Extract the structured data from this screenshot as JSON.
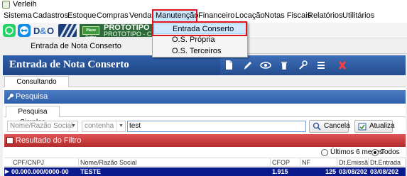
{
  "window": {
    "title": "Verleih"
  },
  "menubar": {
    "items": [
      {
        "label": "Sistema"
      },
      {
        "label": "Cadastros"
      },
      {
        "label": "Estoque"
      },
      {
        "label": "Compras"
      },
      {
        "label": "Vendas"
      },
      {
        "label": "Manutenção"
      },
      {
        "label": "Financeiro"
      },
      {
        "label": "Locação"
      },
      {
        "label": "Notas Fiscais"
      },
      {
        "label": "Relatórios"
      },
      {
        "label": "Utilitários"
      }
    ]
  },
  "dropdown": {
    "items": [
      {
        "label": "Entrada Conserto"
      },
      {
        "label": "O.S. Própria"
      },
      {
        "label": "O.S. Terceiros"
      }
    ]
  },
  "toolbar": {
    "banner_logo_text": "Plano Dados",
    "banner_title": "PROTOTIPO PR",
    "banner_subtitle": "PROTOTIPO - CNP",
    "accent": "#2e6b3a"
  },
  "doc_tab": {
    "label": "Entrada de Nota Conserto"
  },
  "header": {
    "title": "Entrada de Nota Conserto",
    "buttons": [
      "new-icon",
      "edit-icon",
      "view-icon",
      "delete-icon",
      "tools-icon",
      "menu-icon",
      "close-icon"
    ]
  },
  "tabs": {
    "consultando": "Consultando Registros"
  },
  "pesquisa": {
    "title": "Pesquisa",
    "subtab": "Pesquisa Simples",
    "field_select": "Nome/Razão Social",
    "operator_select": "contenha",
    "search_value": "test",
    "cancel_label": "Cancela",
    "update_label": "Atualiza"
  },
  "resultado": {
    "title": "Resultado do Filtro",
    "radio_last": "Últimos 6 meses",
    "radio_all": "Todos",
    "selected": "all"
  },
  "grid": {
    "columns": [
      "CPF/CNPJ",
      "Nome/Razão Social",
      "CFOP",
      "NF",
      "Dt.Emissão",
      "Dt.Entrada"
    ],
    "rows": [
      {
        "cpf": "00.000.000/0000-00",
        "nome": "TESTE",
        "cfop": "1.915",
        "nf": "125",
        "emissao": "03/08/202",
        "entrada": "03/08/202"
      }
    ]
  },
  "colors": {
    "header_blue": "#2f5fa8",
    "result_red": "#b22a2a",
    "highlight": "#e0141e",
    "row_selected": "#0a1a8c"
  }
}
